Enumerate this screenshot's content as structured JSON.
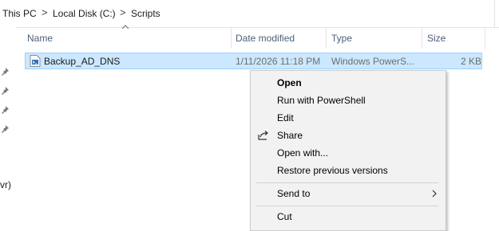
{
  "breadcrumb": {
    "items": [
      "This PC",
      "Local Disk (C:)",
      "Scripts"
    ],
    "separator": ">"
  },
  "nav": {
    "partial_label": "vr)"
  },
  "columns": {
    "name": "Name",
    "date_modified": "Date modified",
    "type": "Type",
    "size": "Size"
  },
  "file": {
    "name": "Backup_AD_DNS",
    "date_modified": "1/11/2026 11:18 PM",
    "type": "Windows PowerS...",
    "size": "2 KB",
    "icon": "powershell-script-icon"
  },
  "context_menu": {
    "items": [
      {
        "label": "Open",
        "bold": true
      },
      {
        "label": "Run with PowerShell"
      },
      {
        "label": "Edit"
      },
      {
        "label": "Share",
        "icon": "share-icon"
      },
      {
        "label": "Open with..."
      },
      {
        "label": "Restore previous versions"
      },
      {
        "label": "Send to",
        "submenu": true
      },
      {
        "label": "Cut"
      }
    ]
  },
  "colors": {
    "selection_bg": "#cce8ff",
    "selection_border": "#99d1ff",
    "menu_bg": "#f2f2f2",
    "header_text": "#4c607a"
  }
}
